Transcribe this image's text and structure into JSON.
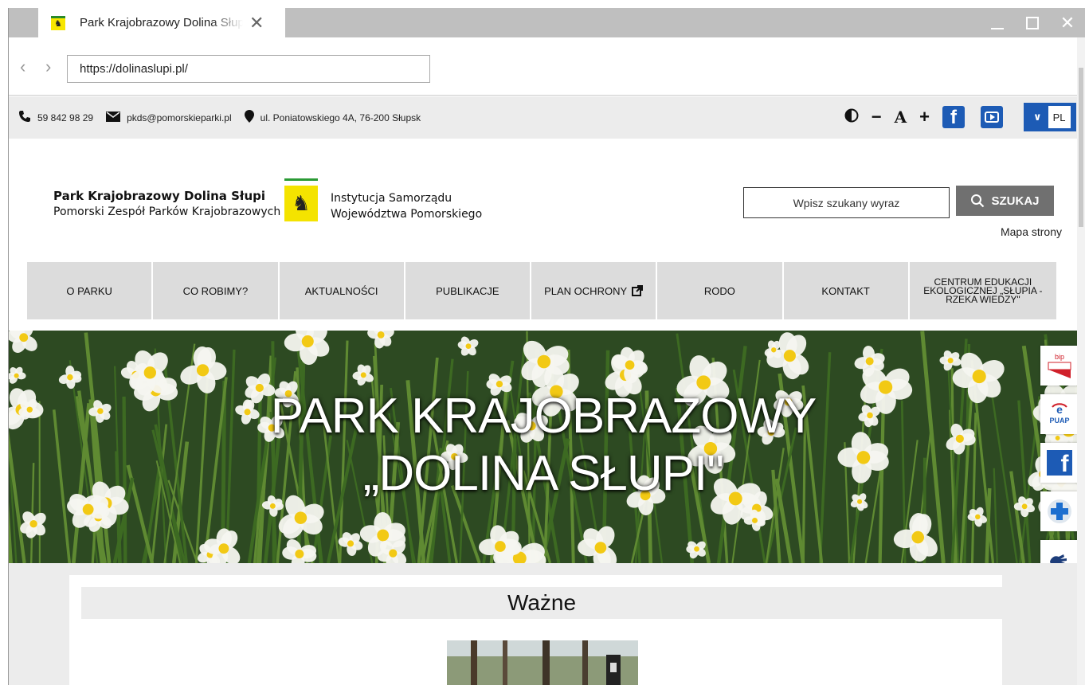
{
  "browser": {
    "tab_title": "Park Krajobrazowy Dolina Słupi",
    "url": "https://dolinaslupi.pl/"
  },
  "topbar": {
    "phone": "59 842 98 29",
    "email": "pkds@pomorskieparki.pl",
    "address": "ul. Poniatowskiego 4A, 76-200 Słupsk",
    "font_decrease": "−",
    "font_label": "A",
    "font_increase": "+",
    "language": "PL"
  },
  "header": {
    "org_line1": "Park Krajobrazowy Dolina Słupi",
    "org_line2": "Pomorski Zespół Parków Krajobrazowych",
    "inst_line1": "Instytucja Samorządu",
    "inst_line2": "Województwa Pomorskiego",
    "search_placeholder": "Wpisz szukany wyraz",
    "search_button": "SZUKAJ",
    "sitemap": "Mapa strony"
  },
  "menu": [
    "O PARKU",
    "CO ROBIMY?",
    "AKTUALNOŚCI",
    "PUBLIKACJE",
    "PLAN OCHRONY",
    "RODO",
    "KONTAKT",
    "CENTRUM EDUKACJI EKOLOGICZNEJ „SŁUPIA - RZEKA WIEDZY\""
  ],
  "hero": {
    "line1": "PARK KRAJOBRAZOWY",
    "line2": "„DOLINA SŁUPI\""
  },
  "side_widgets": {
    "bip": "bip",
    "epuap": "PUAP"
  },
  "content": {
    "section_title": "Ważne"
  },
  "colors": {
    "accent_blue": "#1d5bb5",
    "crest_yellow": "#f4e300",
    "crest_green": "#2a9a35",
    "menu_gray": "#dcdcdc"
  }
}
